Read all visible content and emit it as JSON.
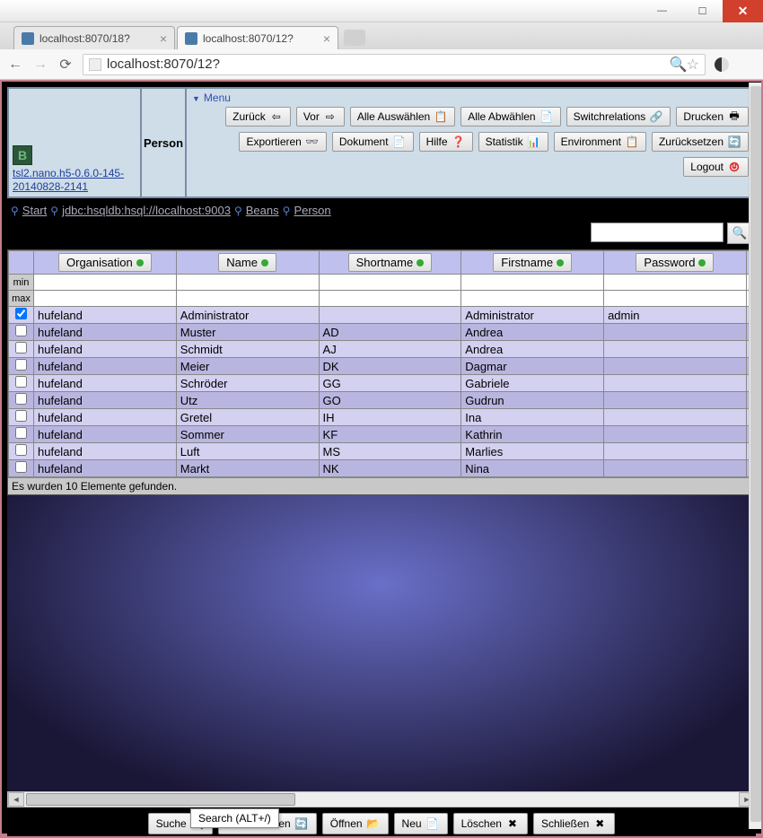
{
  "window": {
    "min": "—",
    "max": "☐",
    "close": "✕"
  },
  "tabs": [
    {
      "title": "localhost:8070/18?",
      "active": false
    },
    {
      "title": "localhost:8070/12?",
      "active": true
    }
  ],
  "url": "localhost:8070/12?",
  "header": {
    "logo_link": "tsl2.nano.h5-0.6.0-145-20140828-2141",
    "title": "Person",
    "menu_label": "Menu"
  },
  "toolbar": {
    "row1": [
      "Zurück",
      "Vor",
      "Alle Auswählen",
      "Alle Abwählen",
      "Switchrelations",
      "Drucken"
    ],
    "row2": [
      "Exportieren",
      "Dokument",
      "Hilfe",
      "Statistik",
      "Environment",
      "Zurücksetzen"
    ],
    "logout": "Logout"
  },
  "breadcrumb": [
    "Start",
    "jdbc:hsqldb:hsql://localhost:9003",
    "Beans",
    "Person"
  ],
  "search_placeholder": "",
  "columns": [
    "Organisation",
    "Name",
    "Shortname",
    "Firstname",
    "Password"
  ],
  "filter_rows": [
    "min",
    "max"
  ],
  "rows": [
    {
      "checked": true,
      "cells": [
        "hufeland",
        "Administrator",
        "",
        "Administrator",
        "admin"
      ]
    },
    {
      "checked": false,
      "cells": [
        "hufeland",
        "Muster",
        "AD",
        "Andrea",
        ""
      ]
    },
    {
      "checked": false,
      "cells": [
        "hufeland",
        "Schmidt",
        "AJ",
        "Andrea",
        ""
      ]
    },
    {
      "checked": false,
      "cells": [
        "hufeland",
        "Meier",
        "DK",
        "Dagmar",
        ""
      ]
    },
    {
      "checked": false,
      "cells": [
        "hufeland",
        "Schröder",
        "GG",
        "Gabriele",
        ""
      ]
    },
    {
      "checked": false,
      "cells": [
        "hufeland",
        "Utz",
        "GO",
        "Gudrun",
        ""
      ]
    },
    {
      "checked": false,
      "cells": [
        "hufeland",
        "Gretel",
        "IH",
        "Ina",
        ""
      ]
    },
    {
      "checked": false,
      "cells": [
        "hufeland",
        "Sommer",
        "KF",
        "Kathrin",
        ""
      ]
    },
    {
      "checked": false,
      "cells": [
        "hufeland",
        "Luft",
        "MS",
        "Marlies",
        ""
      ]
    },
    {
      "checked": false,
      "cells": [
        "hufeland",
        "Markt",
        "NK",
        "Nina",
        ""
      ]
    }
  ],
  "status": "Es wurden 10 Elemente gefunden.",
  "actions": [
    "Suche",
    "Zurücksetzen",
    "Öffnen",
    "Neu",
    "Löschen",
    "Schließen"
  ],
  "tooltip": "Search (ALT+/)"
}
